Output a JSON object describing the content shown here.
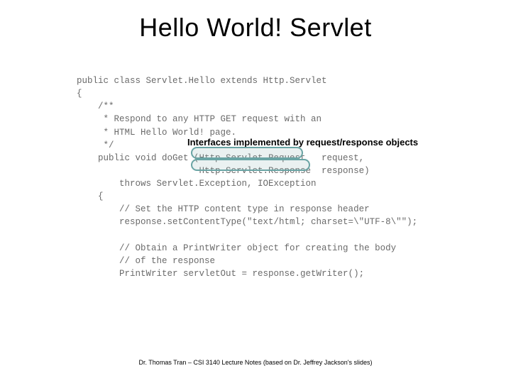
{
  "title": "Hello World! Servlet",
  "annotation": "Interfaces implemented by request/response objects",
  "code": {
    "l01": "public class Servlet.Hello extends Http.Servlet",
    "l02": "{",
    "l03": "    /**",
    "l04": "     * Respond to any HTTP GET request with an",
    "l05": "     * HTML Hello World! page.",
    "l06": "     */",
    "l07": "    public void doGet (Http.Servlet.Request   request,",
    "l08": "                       Http.Servlet.Response  response)",
    "l09": "        throws Servlet.Exception, IOException",
    "l10": "    {",
    "l11": "        // Set the HTTP content type in response header",
    "l12": "        response.setContentType(\"text/html; charset=\\\"UTF-8\\\"\");",
    "l13": "",
    "l14": "        // Obtain a PrintWriter object for creating the body",
    "l15": "        // of the response",
    "l16": "        PrintWriter servletOut = response.getWriter();"
  },
  "footer": "Dr. Thomas Tran – CSI 3140 Lecture Notes (based on Dr. Jeffrey Jackson's slides)"
}
